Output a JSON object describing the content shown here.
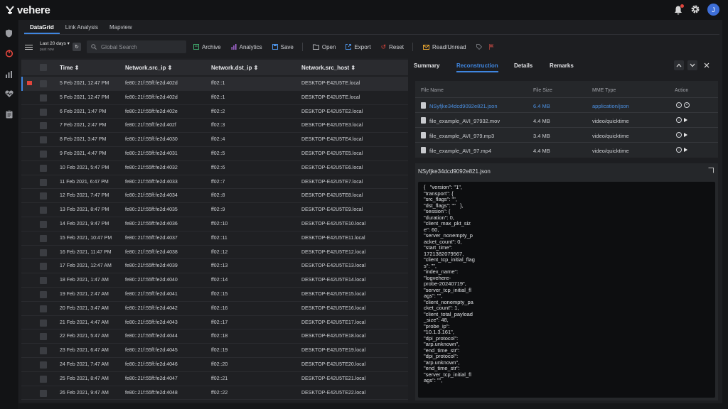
{
  "brand": "vehere",
  "user_initial": "J",
  "tabs": [
    "DataGrid",
    "Link Analysis",
    "Mapview"
  ],
  "toolbar": {
    "date_range": "Last 20 days",
    "date_sub": "past now",
    "search_placeholder": "Global Search",
    "archive": "Archive",
    "analytics": "Analytics",
    "save": "Save",
    "open": "Open",
    "export": "Export",
    "reset": "Reset",
    "read_unread": "Read/Unread"
  },
  "grid": {
    "columns": [
      "Time",
      "Network.src_ip",
      "Network.dst_ip",
      "Network.src_host"
    ],
    "rows": [
      {
        "time": "5 Feb 2021, 12:47 PM",
        "src": "fe80::21f:55ff:fe2d:402d",
        "dst": "ff02::1",
        "host": "DESKTOP-E42U5TE.local"
      },
      {
        "time": "5 Feb 2021, 12:47 PM",
        "src": "fe80::21f:55ff:fe2d:402d",
        "dst": "ff02::1",
        "host": "DESKTOP-E42U5TE.local"
      },
      {
        "time": "6 Feb 2021, 1:47 PM",
        "src": "fe80::21f:55ff:fe2d:402e",
        "dst": "ff02::2",
        "host": "DESKTOP-E42U5TE2.local"
      },
      {
        "time": "7 Feb 2021, 2:47 PM",
        "src": "fe80::21f:55ff:fe2d:402f",
        "dst": "ff02::3",
        "host": "DESKTOP-E42U5TE3.local"
      },
      {
        "time": "8 Feb 2021, 3:47 PM",
        "src": "fe80::21f:55ff:fe2d:4030",
        "dst": "ff02::4",
        "host": "DESKTOP-E42U5TE4.local"
      },
      {
        "time": "9 Feb 2021, 4:47 PM",
        "src": "fe80::21f:55ff:fe2d:4031",
        "dst": "ff02::5",
        "host": "DESKTOP-E42U5TE5.local"
      },
      {
        "time": "10 Feb 2021, 5:47 PM",
        "src": "fe80::21f:55ff:fe2d:4032",
        "dst": "ff02::6",
        "host": "DESKTOP-E42U5TE6.local"
      },
      {
        "time": "11 Feb 2021, 6:47 PM",
        "src": "fe80::21f:55ff:fe2d:4033",
        "dst": "ff02::7",
        "host": "DESKTOP-E42U5TE7.local"
      },
      {
        "time": "12 Feb 2021, 7:47 PM",
        "src": "fe80::21f:55ff:fe2d:4034",
        "dst": "ff02::8",
        "host": "DESKTOP-E42U5TE8.local"
      },
      {
        "time": "13 Feb 2021, 8:47 PM",
        "src": "fe80::21f:55ff:fe2d:4035",
        "dst": "ff02::9",
        "host": "DESKTOP-E42U5TE9.local"
      },
      {
        "time": "14 Feb 2021, 9:47 PM",
        "src": "fe80::21f:55ff:fe2d:4036",
        "dst": "ff02::10",
        "host": "DESKTOP-E42U5TE10.local"
      },
      {
        "time": "15 Feb 2021, 10:47 PM",
        "src": "fe80::21f:55ff:fe2d:4037",
        "dst": "ff02::11",
        "host": "DESKTOP-E42U5TE11.local"
      },
      {
        "time": "16 Feb 2021, 11:47 PM",
        "src": "fe80::21f:55ff:fe2d:4038",
        "dst": "ff02::12",
        "host": "DESKTOP-E42U5TE12.local"
      },
      {
        "time": "17 Feb 2021, 12:47 AM",
        "src": "fe80::21f:55ff:fe2d:4039",
        "dst": "ff02::13",
        "host": "DESKTOP-E42U5TE13.local"
      },
      {
        "time": "18 Feb 2021, 1:47 AM",
        "src": "fe80::21f:55ff:fe2d:4040",
        "dst": "ff02::14",
        "host": "DESKTOP-E42U5TE14.local"
      },
      {
        "time": "19 Feb 2021, 2:47 AM",
        "src": "fe80::21f:55ff:fe2d:4041",
        "dst": "ff02::15",
        "host": "DESKTOP-E42U5TE15.local"
      },
      {
        "time": "20 Feb 2021, 3:47 AM",
        "src": "fe80::21f:55ff:fe2d:4042",
        "dst": "ff02::16",
        "host": "DESKTOP-E42U5TE16.local"
      },
      {
        "time": "21 Feb 2021, 4:47 AM",
        "src": "fe80::21f:55ff:fe2d:4043",
        "dst": "ff02::17",
        "host": "DESKTOP-E42U5TE17.local"
      },
      {
        "time": "22 Feb 2021, 5:47 AM",
        "src": "fe80::21f:55ff:fe2d:4044",
        "dst": "ff02::18",
        "host": "DESKTOP-E42U5TE18.local"
      },
      {
        "time": "23 Feb 2021, 6:47 AM",
        "src": "fe80::21f:55ff:fe2d:4045",
        "dst": "ff02::19",
        "host": "DESKTOP-E42U5TE19.local"
      },
      {
        "time": "24 Feb 2021, 7:47 AM",
        "src": "fe80::21f:55ff:fe2d:4046",
        "dst": "ff02::20",
        "host": "DESKTOP-E42U5TE20.local"
      },
      {
        "time": "25 Feb 2021, 8:47 AM",
        "src": "fe80::21f:55ff:fe2d:4047",
        "dst": "ff02::21",
        "host": "DESKTOP-E42U5TE21.local"
      },
      {
        "time": "26 Feb 2021, 9:47 AM",
        "src": "fe80::21f:55ff:fe2d:4048",
        "dst": "ff02::22",
        "host": "DESKTOP-E42U5TE22.local"
      }
    ]
  },
  "detail": {
    "tabs": [
      "Summary",
      "Reconstruction",
      "Details",
      "Remarks"
    ],
    "file_headers": [
      "File Name",
      "File Size",
      "MME Type",
      "Action"
    ],
    "files": [
      {
        "name": "NSyfjke34dcd9092e821.json",
        "size": "6.4 MB",
        "type": "application/json"
      },
      {
        "name": "file_example_AVI_97932.mov",
        "size": "4.4 MB",
        "type": "video/quicktime"
      },
      {
        "name": "file_example_AVI_979.mp3",
        "size": "3.4 MB",
        "type": "video/quicktime"
      },
      {
        "name": "file_example_AVI_97.mp4",
        "size": "4.4 MB",
        "type": "video/quicktime"
      }
    ],
    "viewer_title": "NSyfjke34dcd9092e821.json",
    "json_text": "{   \"version\": \"1\",\n\"transport\": {\n\"src_flags\": \"\",\n\"dst_flags\": \"\"   },\n\"session\": {\n\"duration\": 0,\n\"client_max_pkt_siz\ne\": 60,\n\"server_nonempty_p\nacket_count\": 0,\n\"start_time\":\n1721382079567,\n\"client_tcp_initial_flag\ns\": \"\",\n\"index_name\":\n\"logvehere-\nprobe-20240719\",\n\"server_tcp_initial_fl\nags\": \"\",\n\"client_nonempty_pa\ncket_count\": 1,\n\"client_total_payload\n_size\": 48,\n\"probe_ip\":\n\"10.1.3.161\",\n\"dpi_protocol\":\n\"arp.unknown\",\n\"end_time_str\":\n\"dpi_protocol\":\n\"arp.unknown\",\n\"end_time_str\":\n\"server_tcp_initial_fl\nags\": \"\","
  }
}
